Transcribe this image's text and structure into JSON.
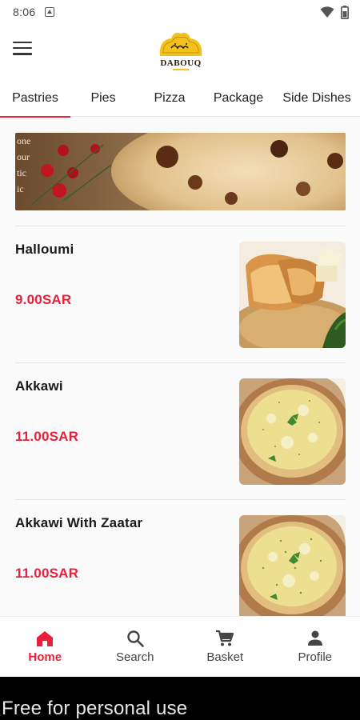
{
  "status_bar": {
    "time": "8:06",
    "icons": [
      "notification-icon",
      "wifi-icon",
      "battery-icon"
    ]
  },
  "header": {
    "logo_text_arabic": "دابوق",
    "logo_text": "DABOUQ",
    "menu_icon": "hamburger-menu-icon"
  },
  "tabs": [
    {
      "label": "Pastries",
      "active": true
    },
    {
      "label": "Pies",
      "active": false
    },
    {
      "label": "Pizza",
      "active": false
    },
    {
      "label": "Package",
      "active": false
    },
    {
      "label": "Side Dishes",
      "active": false
    }
  ],
  "products": [
    {
      "name": "Halloumi",
      "price": "9.00SAR"
    },
    {
      "name": "Akkawi",
      "price": "11.00SAR"
    },
    {
      "name": "Akkawi With Zaatar",
      "price": "11.00SAR"
    }
  ],
  "bottom_nav": [
    {
      "label": "Home",
      "icon": "home-icon",
      "active": true
    },
    {
      "label": "Search",
      "icon": "search-icon",
      "active": false
    },
    {
      "label": "Basket",
      "icon": "cart-icon",
      "active": false
    },
    {
      "label": "Profile",
      "icon": "person-icon",
      "active": false
    }
  ],
  "watermark": "Free for personal use",
  "colors": {
    "accent": "#e8213a",
    "logo_gold": "#f2c21b"
  }
}
